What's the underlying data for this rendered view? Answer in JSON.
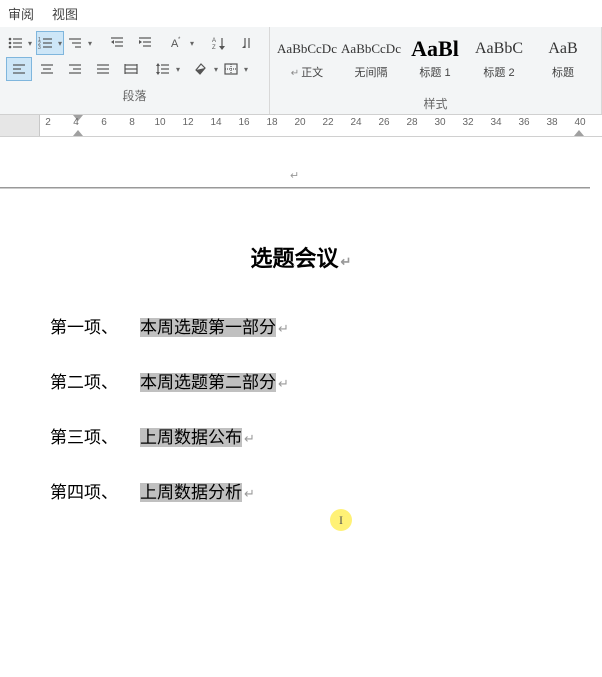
{
  "tabs": {
    "review": "审阅",
    "view": "视图"
  },
  "groups": {
    "paragraph": "段落",
    "styles": "样式"
  },
  "styles": [
    {
      "preview": "AaBbCcDc",
      "name": "正文",
      "size": "small",
      "mark": true
    },
    {
      "preview": "AaBbCcDc",
      "name": "无间隔",
      "size": "small",
      "mark": false
    },
    {
      "preview": "AaBl",
      "name": "标题 1",
      "size": "big",
      "mark": false
    },
    {
      "preview": "AaBbC",
      "name": "标题 2",
      "size": "med",
      "mark": false
    },
    {
      "preview": "AaB",
      "name": "标题",
      "size": "med",
      "mark": false
    }
  ],
  "ruler": {
    "ticks": [
      2,
      4,
      6,
      8,
      10,
      12,
      14,
      16,
      18,
      20,
      22,
      24,
      26,
      28,
      30,
      32,
      34,
      36,
      38,
      40
    ]
  },
  "doc": {
    "title": "选题会议",
    "items": [
      {
        "num": "第一项、",
        "text": "本周选题第一部分"
      },
      {
        "num": "第二项、",
        "text": "本周选题第二部分"
      },
      {
        "num": "第三项、",
        "text": "上周数据公布"
      },
      {
        "num": "第四项、",
        "text": "上周数据分析"
      }
    ],
    "header_mark": "↵"
  },
  "cursor_glyph": "I"
}
